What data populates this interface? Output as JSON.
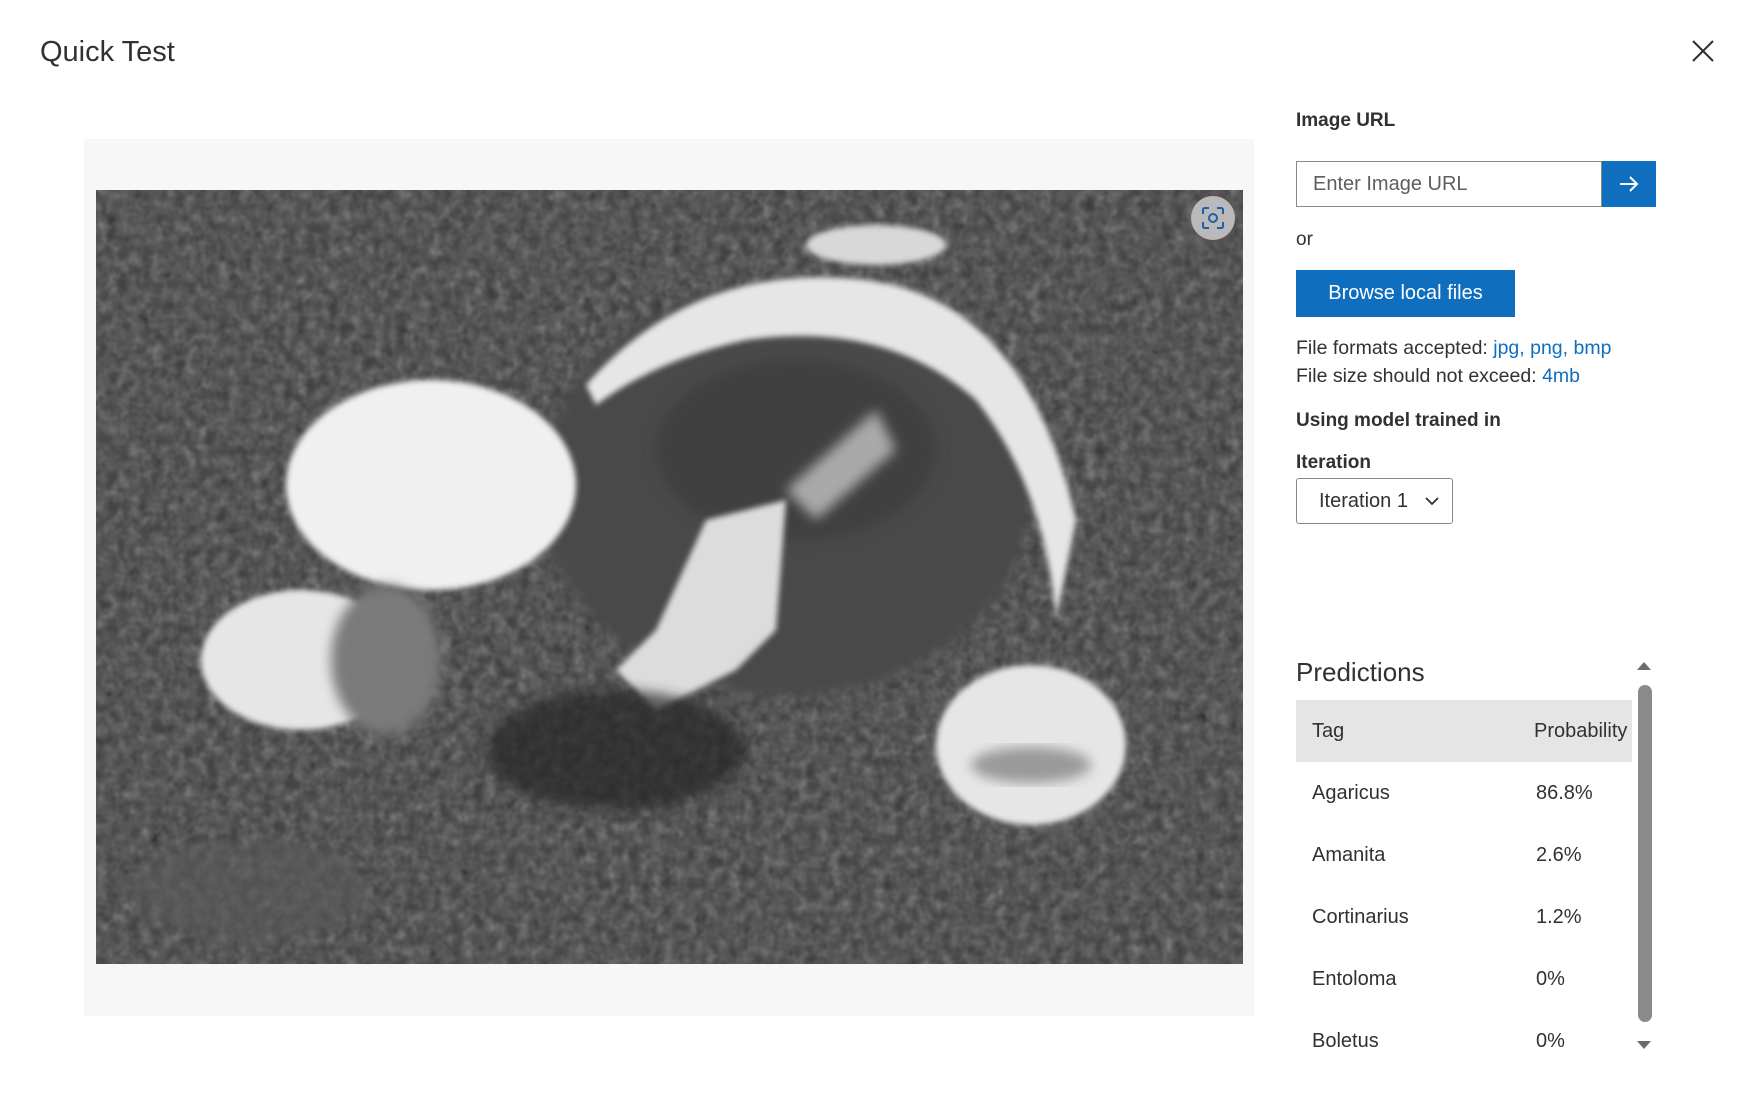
{
  "dialog": {
    "title": "Quick Test",
    "close_icon": "close-icon"
  },
  "image": {
    "capture_icon": "screenshot-capture-icon"
  },
  "upload": {
    "image_url_label": "Image URL",
    "image_url_placeholder": "Enter Image URL",
    "go_icon": "arrow-right-icon",
    "or_text": "or",
    "browse_label": "Browse local files",
    "formats_prefix": "File formats accepted: ",
    "formats_value": "jpg, png, bmp",
    "size_prefix": "File size should not exceed: ",
    "size_value": "4mb"
  },
  "model": {
    "using_label": "Using model trained in",
    "iteration_label": "Iteration",
    "iteration_selected": "Iteration 1"
  },
  "predictions": {
    "title": "Predictions",
    "columns": {
      "tag": "Tag",
      "probability": "Probability"
    },
    "rows": [
      {
        "tag": "Agaricus",
        "probability": "86.8%"
      },
      {
        "tag": "Amanita",
        "probability": "2.6%"
      },
      {
        "tag": "Cortinarius",
        "probability": "1.2%"
      },
      {
        "tag": "Entoloma",
        "probability": "0%"
      },
      {
        "tag": "Boletus",
        "probability": "0%"
      }
    ]
  },
  "colors": {
    "accent": "#106ebe",
    "panel_bg": "#f7f7f7",
    "table_header_bg": "#e5e5e5"
  }
}
